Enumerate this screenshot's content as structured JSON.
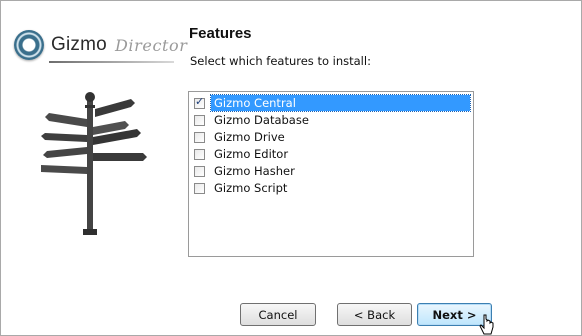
{
  "logo": {
    "name": "Gizmo",
    "tagline": "Director"
  },
  "page": {
    "title": "Features",
    "subtitle": "Select which features to install:"
  },
  "features": [
    {
      "label": "Gizmo Central",
      "checked": true,
      "selected": true
    },
    {
      "label": "Gizmo Database",
      "checked": false,
      "selected": false
    },
    {
      "label": "Gizmo Drive",
      "checked": false,
      "selected": false
    },
    {
      "label": "Gizmo Editor",
      "checked": false,
      "selected": false
    },
    {
      "label": "Gizmo Hasher",
      "checked": false,
      "selected": false
    },
    {
      "label": "Gizmo Script",
      "checked": false,
      "selected": false
    }
  ],
  "buttons": {
    "cancel": "Cancel",
    "back": "< Back",
    "next": "Next >"
  },
  "colors": {
    "selection": "#3399ff",
    "primary_button": "#bee6fd",
    "logo_accent": "#3a6f8c"
  }
}
